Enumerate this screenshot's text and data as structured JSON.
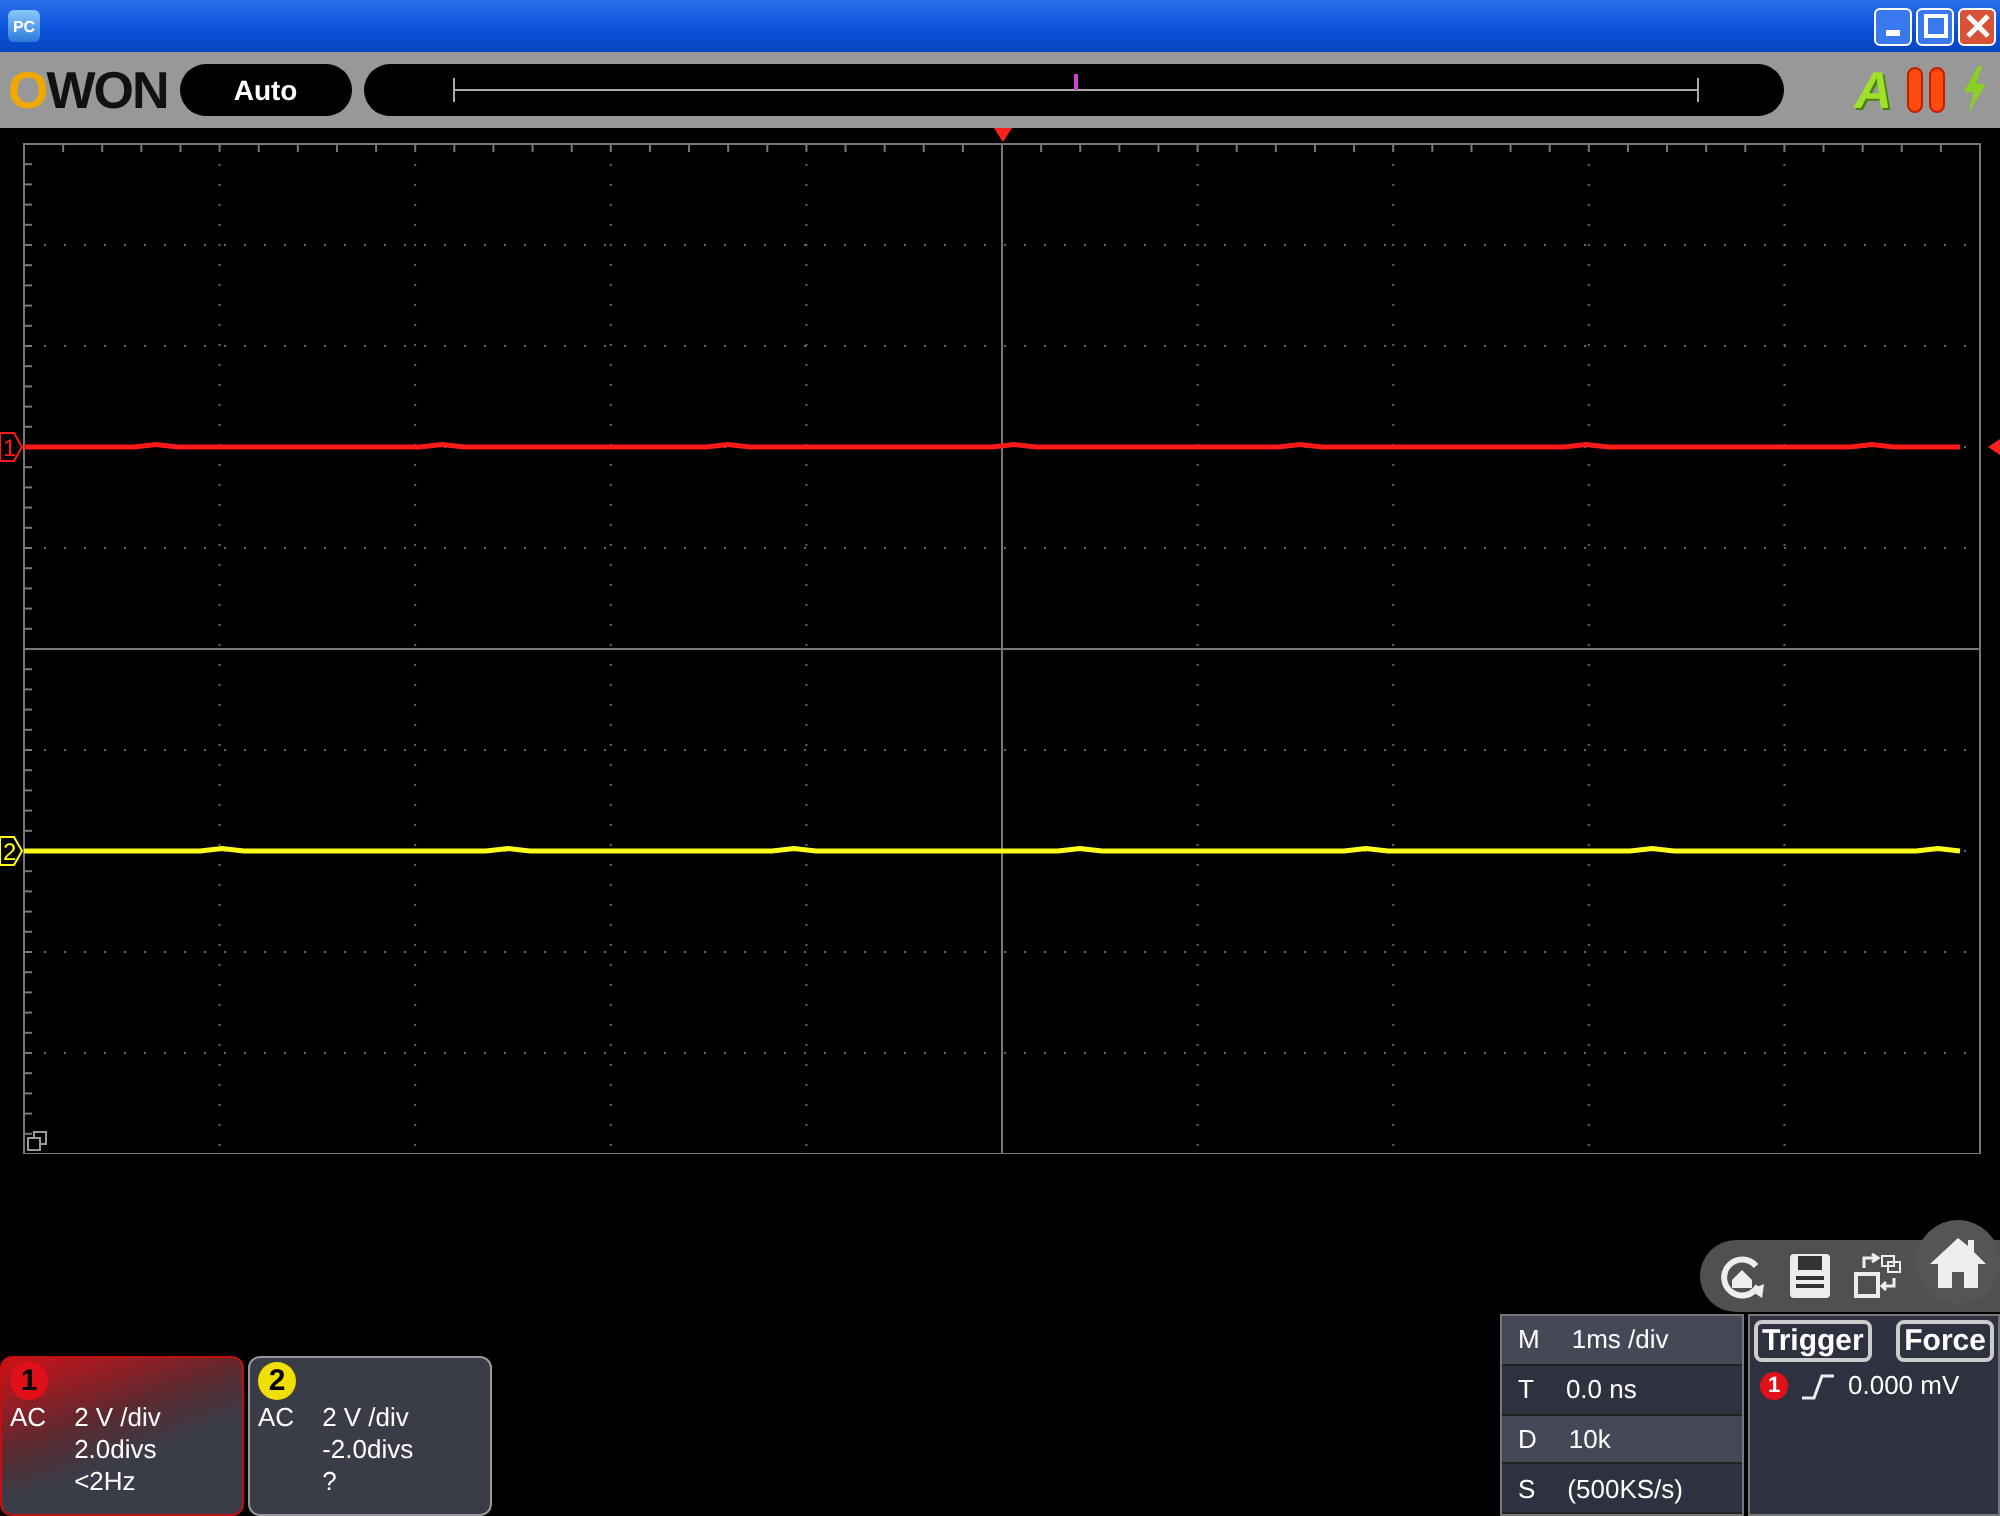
{
  "window": {
    "icon_text": "PC"
  },
  "toolbar": {
    "logo": "OWON",
    "mode": "Auto",
    "auto_icon_text": "A"
  },
  "traces": [
    {
      "label": "1",
      "color": "#ff1a1a"
    },
    {
      "label": "2",
      "color": "#ffff1a"
    }
  ],
  "channels": [
    {
      "number": "1",
      "color": "#e0101a",
      "selected": true,
      "coupling": "AC",
      "scale": "2 V /div",
      "offset": "2.0divs",
      "frequency": "<2Hz"
    },
    {
      "number": "2",
      "color": "#f0e000",
      "selected": false,
      "coupling": "AC",
      "scale": "2 V /div",
      "offset": "-2.0divs",
      "frequency": "?"
    }
  ],
  "timebase": [
    {
      "key": "M",
      "value": "1ms /div"
    },
    {
      "key": "T",
      "value": "0.0 ns"
    },
    {
      "key": "D",
      "value": "10k"
    },
    {
      "key": "S",
      "value": "(500KS/s)"
    }
  ],
  "trigger": {
    "title": "Trigger",
    "force": "Force",
    "source": "1",
    "value": "0.000 mV"
  }
}
